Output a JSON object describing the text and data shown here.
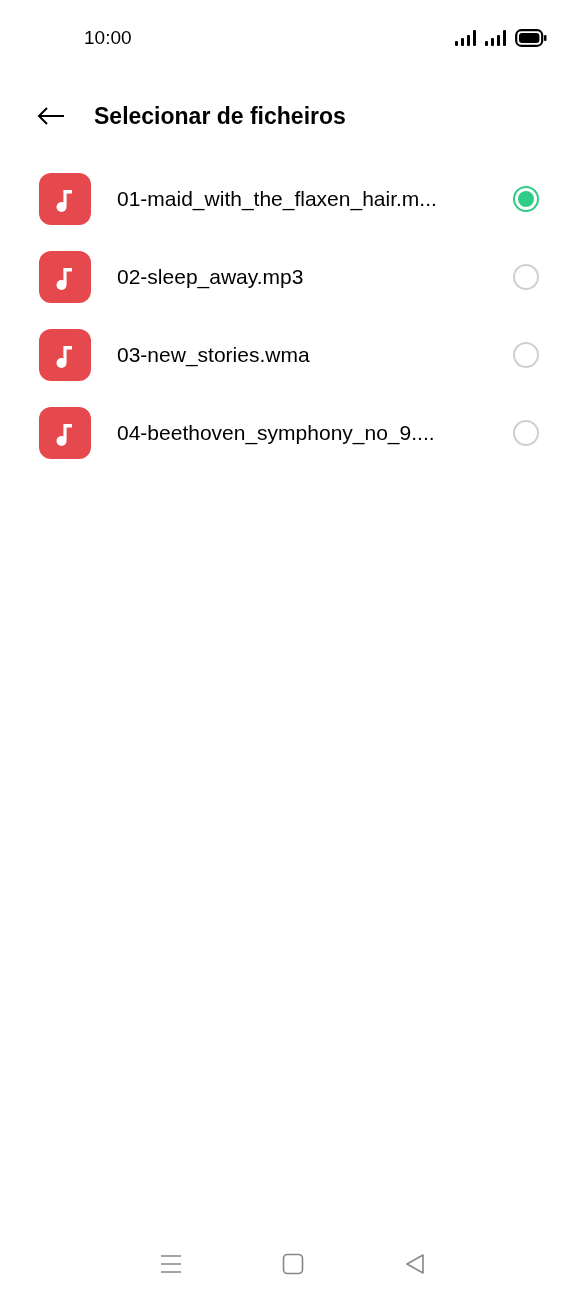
{
  "status_bar": {
    "time": "10:00"
  },
  "header": {
    "title": "Selecionar de ficheiros"
  },
  "files": [
    {
      "name": "01-maid_with_the_flaxen_hair.m...",
      "selected": true
    },
    {
      "name": "02-sleep_away.mp3",
      "selected": false
    },
    {
      "name": "03-new_stories.wma",
      "selected": false
    },
    {
      "name": "04-beethoven_symphony_no_9....",
      "selected": false
    }
  ]
}
